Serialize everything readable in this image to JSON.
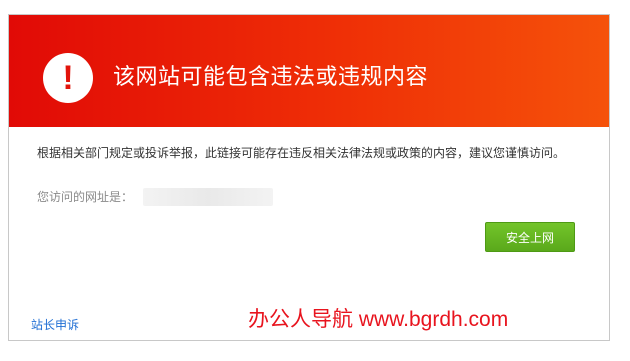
{
  "header": {
    "title": "该网站可能包含违法或违规内容",
    "icon": "exclamation-icon",
    "icon_glyph": "!",
    "gradient_colors": [
      "#e10a06",
      "#f5520a"
    ]
  },
  "body": {
    "description": "根据相关部门规定或投诉举报，此链接可能存在违反相关法律法规或政策的内容，建议您谨慎访问。",
    "url_label": "您访问的网址是：",
    "url_value": ""
  },
  "buttons": {
    "safe_label": "安全上网",
    "safe_color": "#5aa91b"
  },
  "footer": {
    "appeal_link": "站长申诉",
    "link_color": "#1f6ed4"
  },
  "watermark": {
    "text": "办公人导航 www.bgrdh.com",
    "color": "#e8141e"
  }
}
